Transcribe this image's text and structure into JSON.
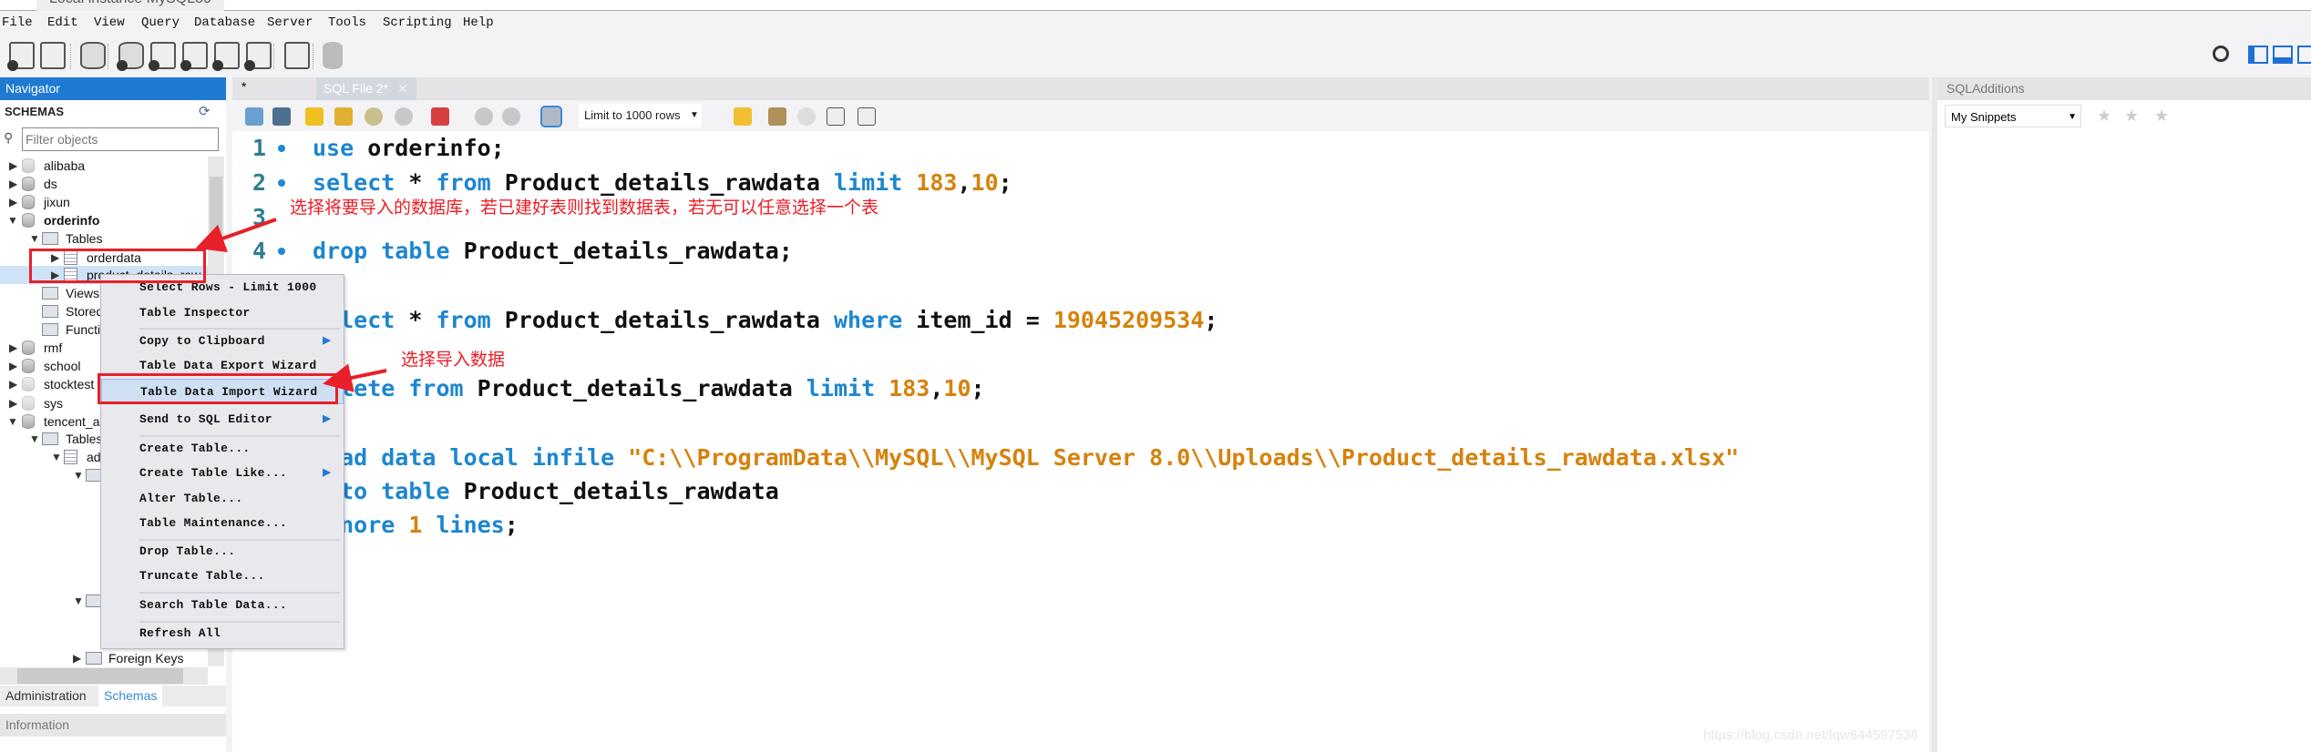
{
  "window": {
    "tab_title": "Local instance MySQL80"
  },
  "menubar": [
    "File",
    "Edit",
    "View",
    "Query",
    "Database",
    "Server",
    "Tools",
    "Scripting",
    "Help"
  ],
  "navigator": {
    "title": "Navigator",
    "schemas_label": "SCHEMAS",
    "filter_placeholder": "Filter objects",
    "tree": {
      "alibaba": "alibaba",
      "ds": "ds",
      "jixun": "jixun",
      "orderinfo": "orderinfo",
      "tables": "Tables",
      "orderdata": "orderdata",
      "product": "product_details_raw",
      "views": "Views",
      "stored": "Stored Procedures",
      "functions": "Functions",
      "rmf": "rmf",
      "school": "school",
      "stocktest": "stocktest",
      "sys": "sys",
      "tencent": "tencent_a",
      "tables2": "Tables",
      "ad": "ad",
      "foreign_keys": "Foreign Keys"
    },
    "tabs": {
      "administration": "Administration",
      "schemas": "Schemas"
    },
    "information_title": "Information"
  },
  "editor": {
    "tab_modified_marker": "*",
    "tab_label": "SQL File 2*",
    "limit_select": "Limit to 1000 rows",
    "line_numbers": [
      "1",
      "2",
      "3",
      "4"
    ]
  },
  "code": {
    "l1": [
      [
        "kw",
        "use"
      ],
      [
        "id",
        " orderinfo;"
      ]
    ],
    "l2": [
      [
        "kw",
        "select"
      ],
      [
        "id",
        " * "
      ],
      [
        "kw",
        "from"
      ],
      [
        "id",
        " Product_details_rawdata "
      ],
      [
        "kw",
        "limit"
      ],
      [
        "num",
        " 183"
      ],
      [
        "id",
        ","
      ],
      [
        "num",
        "10"
      ],
      [
        "id",
        ";"
      ]
    ],
    "l4": [
      [
        "kw",
        "drop table"
      ],
      [
        "id",
        " Product_details_rawdata;"
      ]
    ],
    "l5": [
      [
        "kw",
        "select"
      ],
      [
        "id",
        " * "
      ],
      [
        "kw",
        "from"
      ],
      [
        "id",
        " Product_details_rawdata "
      ],
      [
        "kw",
        "where"
      ],
      [
        "id",
        " item_id = "
      ],
      [
        "num",
        "19045209534"
      ],
      [
        "id",
        ";"
      ]
    ],
    "l6": [
      [
        "kw",
        "delete from"
      ],
      [
        "id",
        " Product_details_rawdata "
      ],
      [
        "kw",
        "limit"
      ],
      [
        "num",
        " 183"
      ],
      [
        "id",
        ","
      ],
      [
        "num",
        "10"
      ],
      [
        "id",
        ";"
      ]
    ],
    "l7": [
      [
        "kw",
        "load data local infile"
      ],
      [
        "str",
        " \"C:\\\\ProgramData\\\\MySQL\\\\MySQL Server 8.0\\\\Uploads\\\\Product_details_rawdata.xlsx\""
      ]
    ],
    "l8": [
      [
        "kw",
        "into table"
      ],
      [
        "id",
        " Product_details_rawdata"
      ]
    ],
    "l9": [
      [
        "kw",
        "ignore"
      ],
      [
        "num",
        " 1"
      ],
      [
        "kw",
        " lines"
      ],
      [
        "id",
        ";"
      ]
    ]
  },
  "context_menu": {
    "items": [
      "Select Rows - Limit 1000",
      "Table Inspector",
      "Copy to Clipboard",
      "Table Data Export Wizard",
      "Table Data Import Wizard",
      "Send to SQL Editor",
      "Create Table...",
      "Create Table Like...",
      "Alter Table...",
      "Table Maintenance...",
      "Drop Table...",
      "Truncate Table...",
      "Search Table Data...",
      "Refresh All"
    ],
    "highlighted": "Table Data Import Wizard"
  },
  "sql_additions": {
    "title": "SQLAdditions",
    "snippets_select": "My Snippets"
  },
  "annotations": {
    "note1": "选择将要导入的数据库，若已建好表则找到数据表，若无可以任意选择一个表",
    "note2": "选择导入数据",
    "color": "#ee1c24"
  },
  "watermark": "https://blog.csdn.net/lqw844597536",
  "colors": {
    "accent": "#1f7ad2",
    "keyword": "#1c86d0",
    "number": "#d6820c"
  }
}
